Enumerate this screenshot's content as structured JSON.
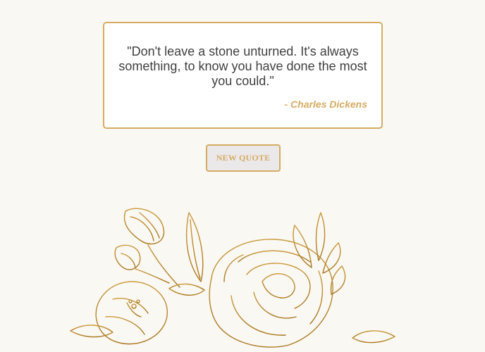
{
  "quote": {
    "text": "\"Don't leave a stone unturned. It's always something, to know you have done the most you could.\"",
    "author": "- Charles Dickens"
  },
  "button": {
    "label": "NEW QUOTE"
  },
  "illustration": {
    "name": "golden-rose-flower-illustration"
  },
  "colors": {
    "background": "#faf8f2",
    "accent": "#d4ac62",
    "text": "#3f3f3f",
    "button_bg": "#ebe8ea"
  }
}
